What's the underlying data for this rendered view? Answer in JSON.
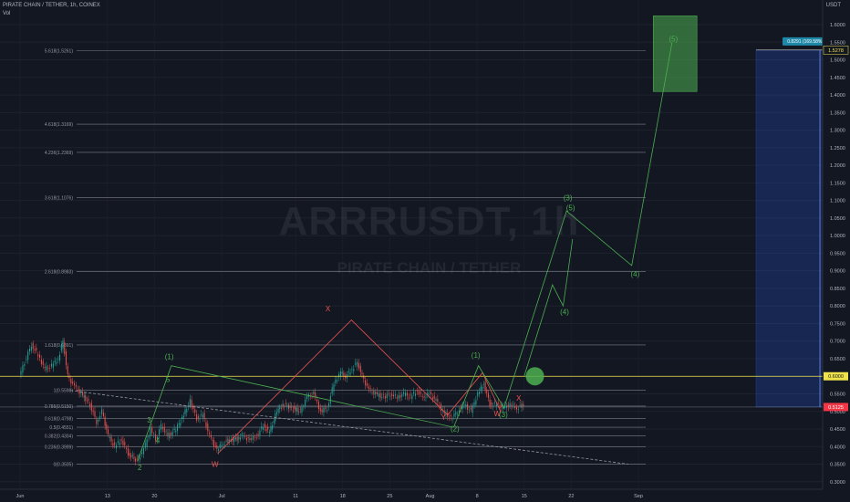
{
  "header": {
    "title": "PIRATE CHAIN / TETHER, 1h, COINEX",
    "vol_label": "Vol",
    "currency": "USDT"
  },
  "watermark": {
    "symbol": "ARRRUSDT, 1h",
    "name": "PIRATE CHAIN / TETHER"
  },
  "chart_data": {
    "type": "candlestick",
    "symbol": "ARRRUSDT",
    "interval": "1h",
    "exchange": "COINEX",
    "ylim": [
      0.28,
      1.63
    ],
    "price_ticks": [
      "1.6000",
      "1.5500",
      "1.5000",
      "1.4500",
      "1.4000",
      "1.3500",
      "1.3000",
      "1.2500",
      "1.2000",
      "1.1500",
      "1.1000",
      "1.0500",
      "1.0000",
      "0.9500",
      "0.9000",
      "0.8500",
      "0.8000",
      "0.7500",
      "0.7000",
      "0.6500",
      "0.6000",
      "0.5500",
      "0.5000",
      "0.4500",
      "0.4000",
      "0.3500",
      "0.3000"
    ],
    "x_ticks": [
      {
        "label": "Jun",
        "day": 0
      },
      {
        "label": "13",
        "day": 13
      },
      {
        "label": "20",
        "day": 20
      },
      {
        "label": "Jul",
        "day": 30
      },
      {
        "label": "11",
        "day": 41
      },
      {
        "label": "18",
        "day": 48
      },
      {
        "label": "25",
        "day": 55
      },
      {
        "label": "Aug",
        "day": 61
      },
      {
        "label": "8",
        "day": 68
      },
      {
        "label": "15",
        "day": 75
      },
      {
        "label": "22",
        "day": 82
      },
      {
        "label": "Sep",
        "day": 92
      }
    ],
    "fib_levels": [
      {
        "label": "0(0.3505)",
        "price": 0.3505
      },
      {
        "label": "0.236(0.3999)",
        "price": 0.3999
      },
      {
        "label": "0.382(0.4304)",
        "price": 0.4304
      },
      {
        "label": "0.5(0.4551)",
        "price": 0.4551
      },
      {
        "label": "0.618(0.4798)",
        "price": 0.4798
      },
      {
        "label": "0.786(0.5150)",
        "price": 0.515
      },
      {
        "label": "1(0.5598)",
        "price": 0.5598
      },
      {
        "label": "1.618(0.6891)",
        "price": 0.6891
      },
      {
        "label": "2.618(0.8983)",
        "price": 0.8983
      },
      {
        "label": "3.618(1.1076)",
        "price": 1.1076
      },
      {
        "label": "4.236(1.2369)",
        "price": 1.2369
      },
      {
        "label": "4.618(1.3169)",
        "price": 1.3169
      },
      {
        "label": "5.618(1.5261)",
        "price": 1.5261
      }
    ],
    "horizontal_line": {
      "price": 0.6,
      "label": "0.6000",
      "color": "#f0e34a"
    },
    "last_price": {
      "price": 0.5125,
      "label": "0.5125",
      "color": "#f23645"
    },
    "target_price": {
      "price": 1.5278,
      "label": "1.5278"
    },
    "position_label": "0.8291 (169.58%) 999",
    "candles_close": [
      {
        "day": 0,
        "price": 0.6
      },
      {
        "day": 0.8,
        "price": 0.64
      },
      {
        "day": 1.8,
        "price": 0.69
      },
      {
        "day": 2.8,
        "price": 0.66
      },
      {
        "day": 3.8,
        "price": 0.62
      },
      {
        "day": 4.8,
        "price": 0.63
      },
      {
        "day": 5.8,
        "price": 0.65
      },
      {
        "day": 6.5,
        "price": 0.7
      },
      {
        "day": 7.2,
        "price": 0.6
      },
      {
        "day": 8.2,
        "price": 0.57
      },
      {
        "day": 9.2,
        "price": 0.55
      },
      {
        "day": 10.5,
        "price": 0.52
      },
      {
        "day": 11.5,
        "price": 0.47
      },
      {
        "day": 12.3,
        "price": 0.5
      },
      {
        "day": 13.2,
        "price": 0.43
      },
      {
        "day": 14.2,
        "price": 0.4
      },
      {
        "day": 15.2,
        "price": 0.42
      },
      {
        "day": 16.2,
        "price": 0.38
      },
      {
        "day": 17.5,
        "price": 0.36
      },
      {
        "day": 18.5,
        "price": 0.39
      },
      {
        "day": 19.5,
        "price": 0.45
      },
      {
        "day": 20.3,
        "price": 0.42
      },
      {
        "day": 21.1,
        "price": 0.46
      },
      {
        "day": 22.1,
        "price": 0.43
      },
      {
        "day": 23.3,
        "price": 0.45
      },
      {
        "day": 24.2,
        "price": 0.48
      },
      {
        "day": 25.4,
        "price": 0.53
      },
      {
        "day": 26.4,
        "price": 0.48
      },
      {
        "day": 27.3,
        "price": 0.49
      },
      {
        "day": 28.3,
        "price": 0.43
      },
      {
        "day": 29.4,
        "price": 0.39
      },
      {
        "day": 30.3,
        "price": 0.41
      },
      {
        "day": 31.3,
        "price": 0.42
      },
      {
        "day": 32.2,
        "price": 0.42
      },
      {
        "day": 33.1,
        "price": 0.43
      },
      {
        "day": 34.3,
        "price": 0.42
      },
      {
        "day": 35.3,
        "price": 0.43
      },
      {
        "day": 36.3,
        "price": 0.46
      },
      {
        "day": 37.2,
        "price": 0.44
      },
      {
        "day": 38.3,
        "price": 0.5
      },
      {
        "day": 39.2,
        "price": 0.52
      },
      {
        "day": 40.5,
        "price": 0.51
      },
      {
        "day": 41.8,
        "price": 0.5
      },
      {
        "day": 42.8,
        "price": 0.54
      },
      {
        "day": 43.8,
        "price": 0.55
      },
      {
        "day": 44.8,
        "price": 0.5
      },
      {
        "day": 45.8,
        "price": 0.51
      },
      {
        "day": 46.8,
        "price": 0.58
      },
      {
        "day": 47.8,
        "price": 0.61
      },
      {
        "day": 48.5,
        "price": 0.6
      },
      {
        "day": 49.5,
        "price": 0.62
      },
      {
        "day": 50.3,
        "price": 0.64
      },
      {
        "day": 51.0,
        "price": 0.6
      },
      {
        "day": 52.0,
        "price": 0.56
      },
      {
        "day": 53.0,
        "price": 0.55
      },
      {
        "day": 54.2,
        "price": 0.54
      },
      {
        "day": 55.2,
        "price": 0.55
      },
      {
        "day": 56.2,
        "price": 0.54
      },
      {
        "day": 57.2,
        "price": 0.55
      },
      {
        "day": 58.2,
        "price": 0.54
      },
      {
        "day": 59.2,
        "price": 0.56
      },
      {
        "day": 60.0,
        "price": 0.54
      },
      {
        "day": 61.0,
        "price": 0.55
      },
      {
        "day": 62.0,
        "price": 0.53
      },
      {
        "day": 63.0,
        "price": 0.5
      },
      {
        "day": 64.2,
        "price": 0.48
      },
      {
        "day": 65.2,
        "price": 0.5
      },
      {
        "day": 66.2,
        "price": 0.52
      },
      {
        "day": 67.2,
        "price": 0.5
      },
      {
        "day": 68.2,
        "price": 0.55
      },
      {
        "day": 69.1,
        "price": 0.58
      },
      {
        "day": 70.0,
        "price": 0.52
      },
      {
        "day": 71.0,
        "price": 0.52
      },
      {
        "day": 72.0,
        "price": 0.51
      },
      {
        "day": 73.0,
        "price": 0.52
      },
      {
        "day": 74.0,
        "price": 0.51
      },
      {
        "day": 75.0,
        "price": 0.52
      }
    ],
    "trend_line": [
      {
        "day": 7.5,
        "price": 0.5598
      },
      {
        "day": 90.5,
        "price": 0.35
      }
    ],
    "wave_labels": [
      {
        "text": "X",
        "day": 45.8,
        "price": 0.785,
        "color": "#ef5350"
      },
      {
        "text": "(1)",
        "day": 22.2,
        "price": 0.649,
        "color": "#4caf50"
      },
      {
        "text": "5",
        "day": 22.0,
        "price": 0.584,
        "color": "#4caf50"
      },
      {
        "text": "3",
        "day": 19.2,
        "price": 0.468,
        "color": "#4caf50"
      },
      {
        "text": "4",
        "day": 20.5,
        "price": 0.41,
        "color": "#4caf50"
      },
      {
        "text": "2",
        "day": 17.8,
        "price": 0.333,
        "color": "#4caf50"
      },
      {
        "text": "W",
        "day": 29.0,
        "price": 0.342,
        "color": "#ef5350"
      },
      {
        "text": "(1)",
        "day": 67.8,
        "price": 0.652,
        "color": "#4caf50"
      },
      {
        "text": "X",
        "day": 74.2,
        "price": 0.53,
        "color": "#ef5350"
      },
      {
        "text": "Y",
        "day": 63.0,
        "price": 0.476,
        "color": "#ef5350"
      },
      {
        "text": "(2)",
        "day": 64.7,
        "price": 0.444,
        "color": "#4caf50"
      },
      {
        "text": "W",
        "day": 71.0,
        "price": 0.486,
        "color": "#ef5350"
      },
      {
        "text": "(3)",
        "day": 71.9,
        "price": 0.484,
        "color": "#4caf50"
      },
      {
        "text": "(3)",
        "day": 81.5,
        "price": 1.1,
        "color": "#4caf50"
      },
      {
        "text": "(5)",
        "day": 81.9,
        "price": 1.072,
        "color": "#4caf50"
      },
      {
        "text": "(4)",
        "day": 81.0,
        "price": 0.776,
        "color": "#4caf50"
      },
      {
        "text": "(4)",
        "day": 91.5,
        "price": 0.883,
        "color": "#4caf50"
      },
      {
        "text": "(5)",
        "day": 97.2,
        "price": 1.552,
        "color": "#4caf50"
      }
    ],
    "green_wave": [
      {
        "day": 17.5,
        "price": 0.36
      },
      {
        "day": 22.5,
        "price": 0.63
      },
      {
        "day": 64.5,
        "price": 0.455
      },
      {
        "day": 68.2,
        "price": 0.63
      },
      {
        "day": 72.0,
        "price": 0.51
      },
      {
        "day": 81.3,
        "price": 1.07
      },
      {
        "day": 91.0,
        "price": 0.915
      },
      {
        "day": 97.0,
        "price": 1.55
      }
    ],
    "green_sub_wave": [
      {
        "day": 75.0,
        "price": 0.6
      },
      {
        "day": 79.2,
        "price": 0.86
      },
      {
        "day": 80.8,
        "price": 0.8
      },
      {
        "day": 82.2,
        "price": 0.99
      }
    ],
    "red_wxy": [
      {
        "day": 29.4,
        "price": 0.38
      },
      {
        "day": 49.3,
        "price": 0.76
      },
      {
        "day": 63.6,
        "price": 0.49
      },
      {
        "day": 68.8,
        "price": 0.61
      },
      {
        "day": 71.5,
        "price": 0.5
      }
    ],
    "target_zone": {
      "day_start": 94.2,
      "day_end": 100.7,
      "price_low": 1.41,
      "price_high": 1.625,
      "color": "#4caf50"
    },
    "target_circle": {
      "day": 76.6,
      "price": 0.6,
      "color": "#4caf50"
    },
    "position_box": {
      "day_start": 109.5,
      "day_end": 128.5,
      "price_low": 0.5125,
      "price_high": 1.5278,
      "color": "#2962ff"
    }
  }
}
